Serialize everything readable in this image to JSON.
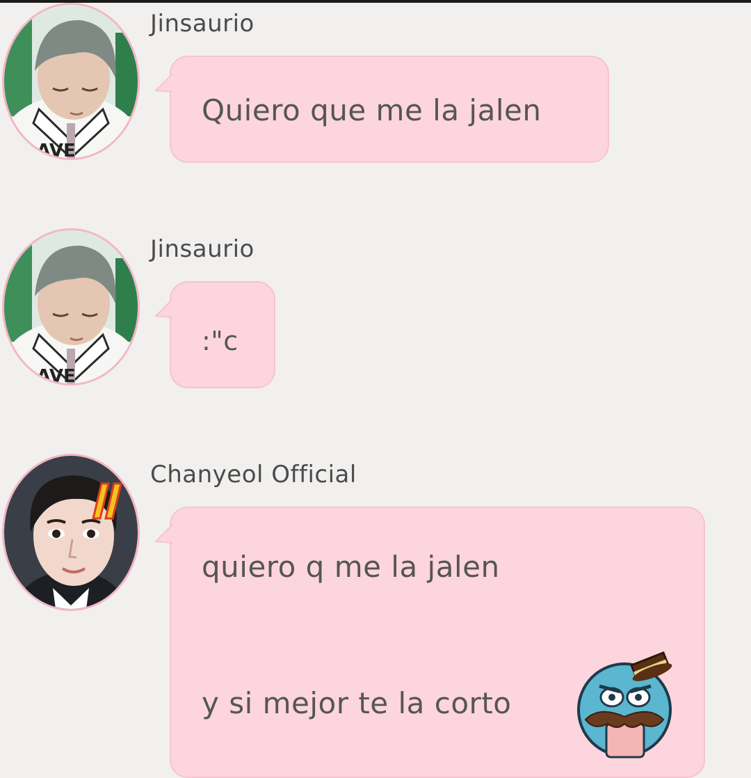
{
  "messages": [
    {
      "sender": "Jinsaurio",
      "lines": [
        "Quiero que me la jalen"
      ]
    },
    {
      "sender": "Jinsaurio",
      "lines": [
        ":\"c"
      ]
    },
    {
      "sender": "Chanyeol Official",
      "lines": [
        "quiero q me la jalen",
        "y si mejor te la corto"
      ],
      "sticker": "mustache-gentleman-sticker"
    }
  ],
  "colors": {
    "background": "#f1f0ef",
    "bubble": "#fcd5df",
    "bubble_border": "#f7c3d1",
    "avatar_border": "#f4b6c6",
    "text": "#555555"
  }
}
